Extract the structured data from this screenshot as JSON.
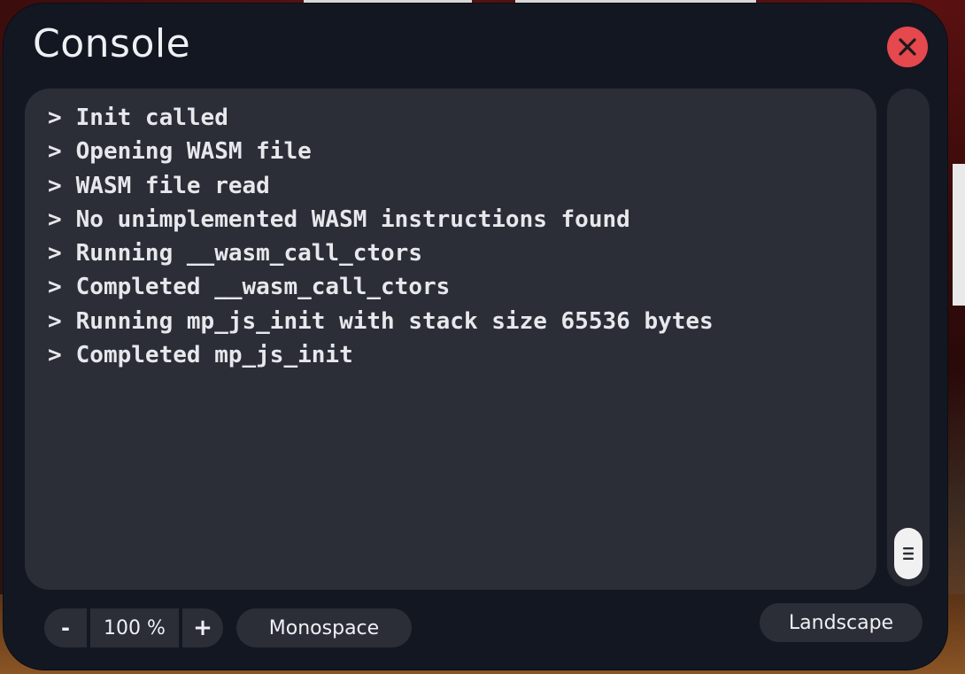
{
  "window": {
    "title": "Console"
  },
  "log": {
    "prompt": ">",
    "lines": [
      "Init called",
      "Opening WASM file",
      "WASM file read",
      "No unimplemented WASM instructions found",
      "Running __wasm_call_ctors",
      "Completed __wasm_call_ctors",
      "Running mp_js_init with stack size 65536 bytes",
      "Completed mp_js_init"
    ]
  },
  "toolbar": {
    "zoom_out_label": "-",
    "zoom_value": "100 %",
    "zoom_in_label": "+",
    "font_label": "Monospace",
    "layout_label": "Landscape"
  },
  "colors": {
    "window_bg": "#131722",
    "panel_bg": "#2b2e37",
    "text": "#e7e8ec",
    "close_button": "#e5484d"
  },
  "icons": {
    "close": "close-icon",
    "scroll_handle": "grip-lines-icon"
  }
}
